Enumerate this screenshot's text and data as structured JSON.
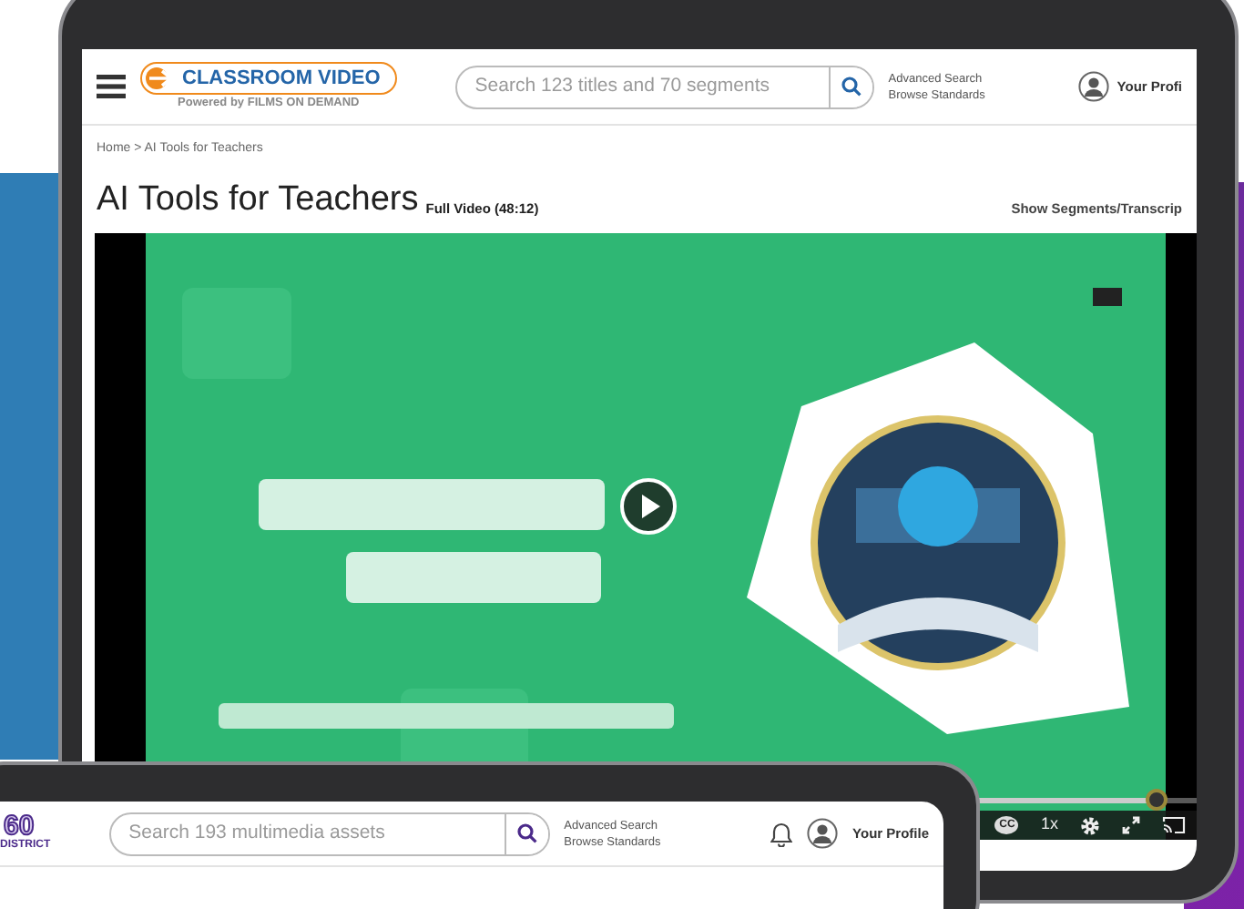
{
  "back_screen": {
    "header": {
      "logo_title": "CLASSROOM VIDEO",
      "logo_tagline": "Powered by **FILMS ON DEMAND**",
      "search": {
        "placeholder": "Search 123 titles and 70 segments"
      },
      "links": [
        "Advanced Search",
        "Browse Standards"
      ],
      "profile": "Your Profi"
    },
    "breadcrumb": "Home > AI Tools for Teachers",
    "title": "AI Tools for Teachers",
    "subtitle": "Full Video (48:12)",
    "segments_link": "Show Segments/Transcrip",
    "video": {
      "kind": "picture",
      "level": 0.96,
      "captions": "CC",
      "speed": "1x"
    }
  },
  "front_screen": {
    "header": {
      "logo_title": "60",
      "logo_subtitle": "DISTRICT",
      "search": {
        "placeholder": "Search 193 multimedia assets"
      },
      "links": [
        "Advanced Search",
        "Browse Standards"
      ],
      "profile": "Your Profile"
    }
  }
}
